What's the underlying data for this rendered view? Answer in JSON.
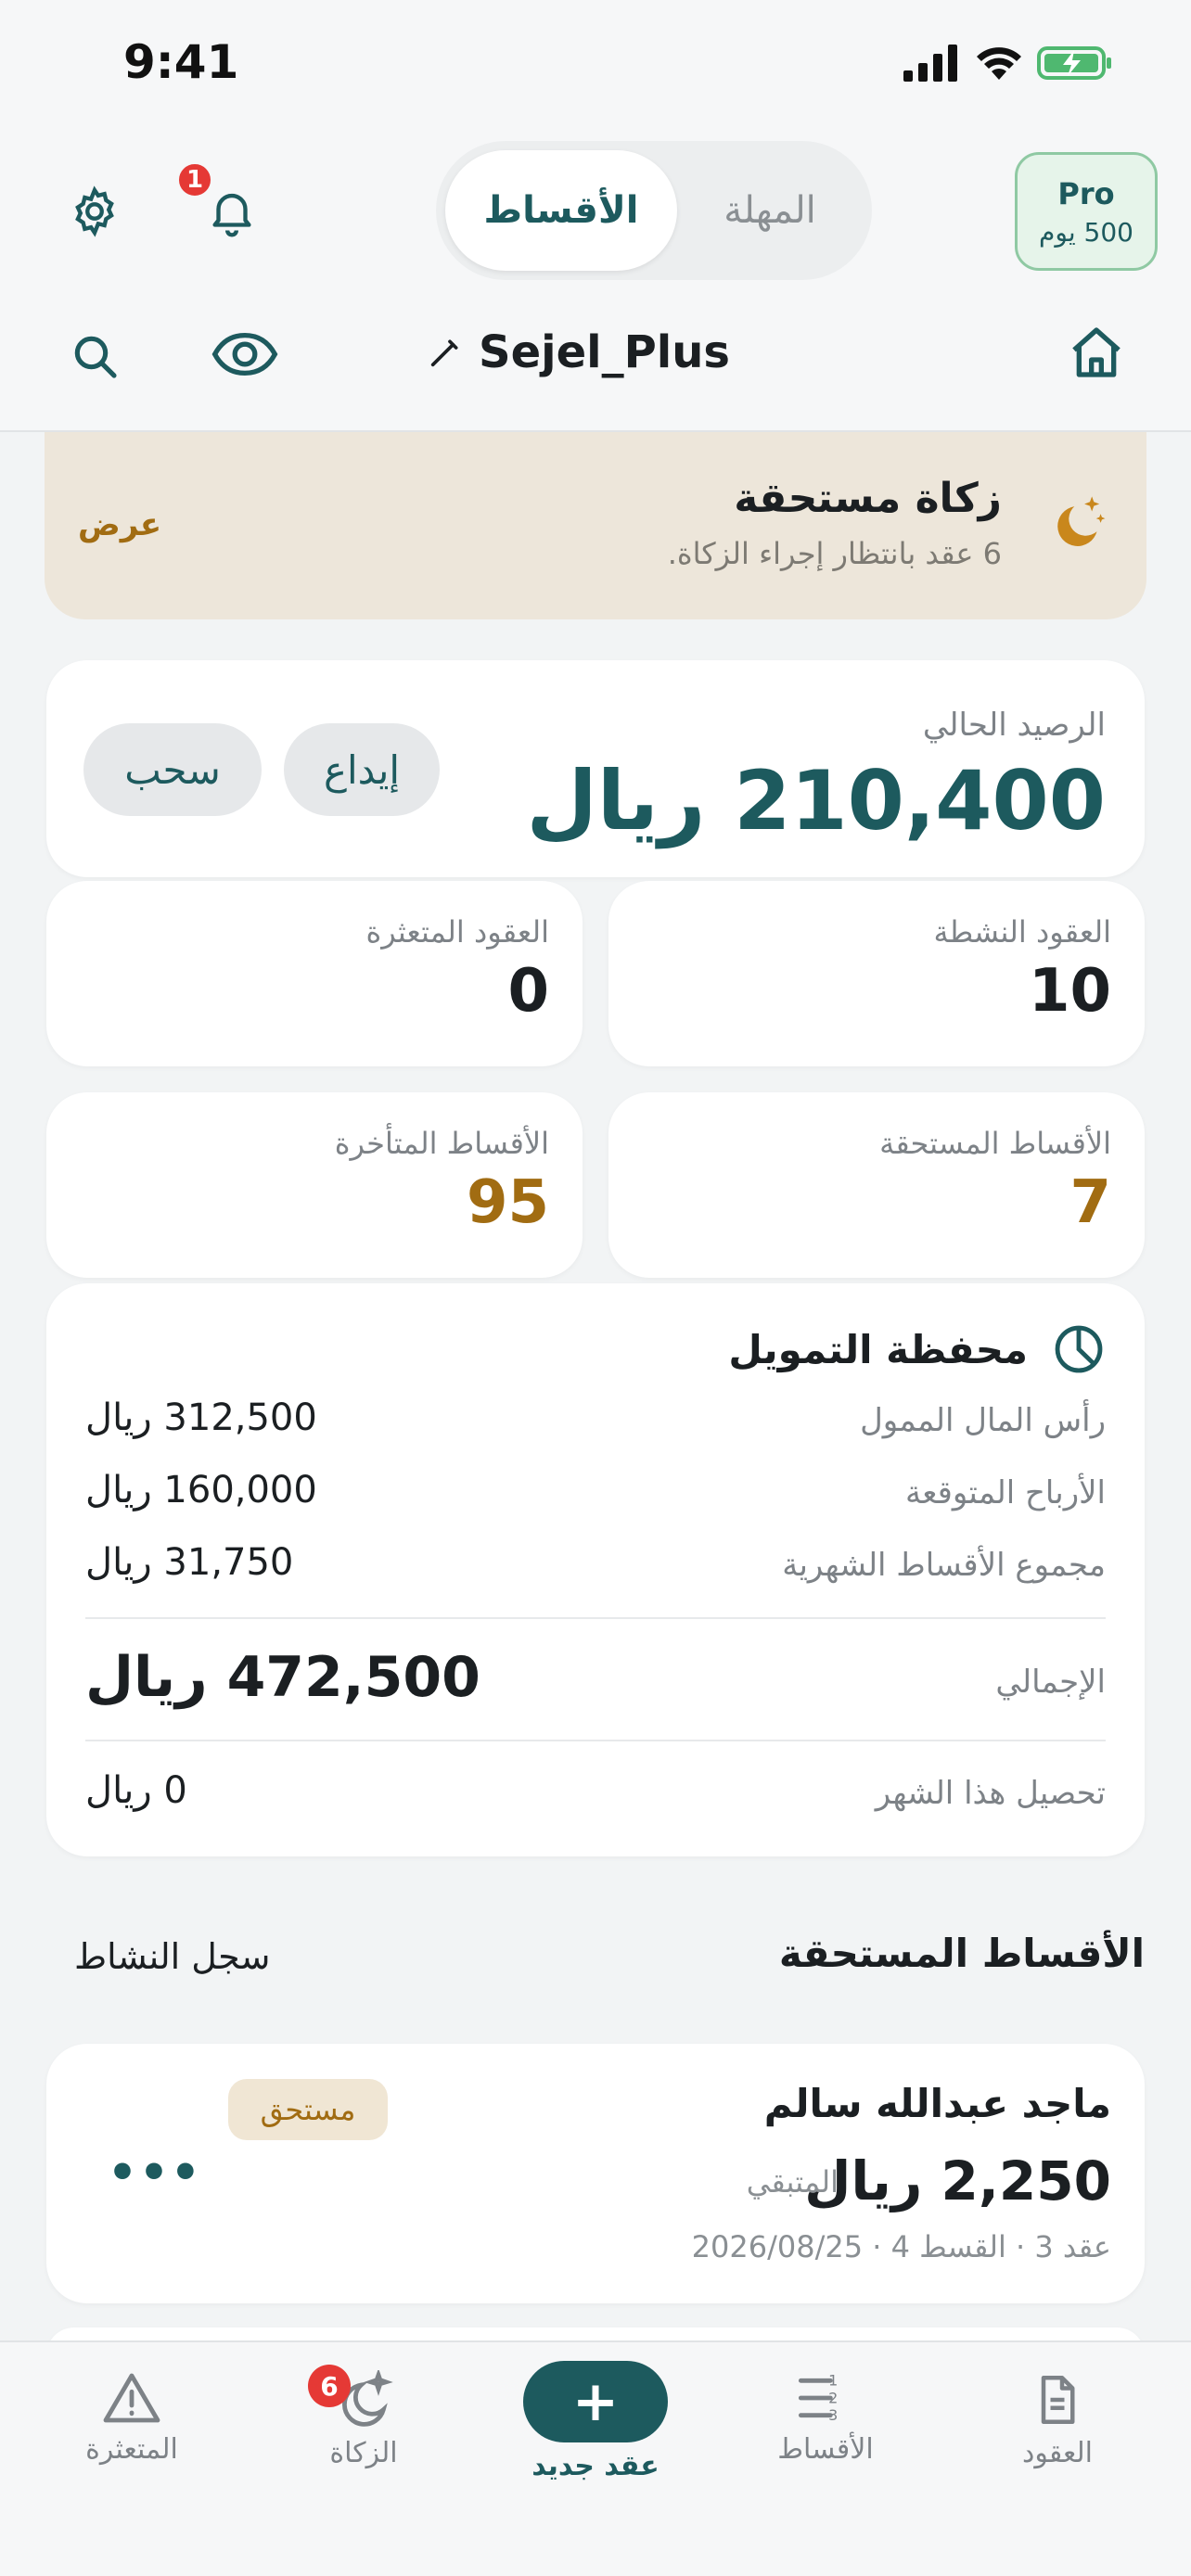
{
  "status_bar": {
    "time": "9:41"
  },
  "header": {
    "notification_count": "1",
    "segments": {
      "active": "الأقساط",
      "inactive": "المهلة"
    },
    "pro": {
      "title": "Pro",
      "subtitle": "500 يوم"
    },
    "username": "Sejel_Plus",
    "icons": [
      "gear-icon",
      "bell-icon",
      "search-icon",
      "eye-icon",
      "pencil-icon",
      "home-icon"
    ]
  },
  "zakat_banner": {
    "title": "زكاة مستحقة",
    "subtitle": "6 عقد بانتظار إجراء الزكاة.",
    "action": "عرض"
  },
  "balance": {
    "label": "الرصيد الحالي",
    "amount": "210,400 ريال",
    "deposit": "إيداع",
    "withdraw": "سحب"
  },
  "stats": {
    "active_contracts": {
      "label": "العقود النشطة",
      "value": "10"
    },
    "defaulted_contracts": {
      "label": "العقود المتعثرة",
      "value": "0"
    },
    "due_installments": {
      "label": "الأقساط المستحقة",
      "value": "7"
    },
    "late_installments": {
      "label": "الأقساط المتأخرة",
      "value": "95"
    }
  },
  "portfolio": {
    "title": "محفظة التمويل",
    "rows": [
      {
        "label": "رأس المال الممول",
        "value": "312,500 ريال"
      },
      {
        "label": "الأرباح المتوقعة",
        "value": "160,000 ريال"
      },
      {
        "label": "مجموع الأقساط الشهرية",
        "value": "31,750 ريال"
      }
    ],
    "total": {
      "label": "الإجمالي",
      "value": "472,500 ريال"
    },
    "month": {
      "label": "تحصيل هذا الشهر",
      "value": "0 ريال"
    }
  },
  "due_section": {
    "title": "الأقساط المستحقة",
    "activity_link": "سجل النشاط",
    "items": [
      {
        "name": "ماجد عبدالله سالم",
        "amount": "2,250 ريال",
        "remaining_label": "المتبقي",
        "meta": "عقد 3 · القسط 4 · 2026/08/25",
        "badge": "مستحق",
        "more": "•••"
      }
    ]
  },
  "tabbar": {
    "contracts": "العقود",
    "installments": "الأقساط",
    "new_contract": "عقد جديد",
    "new_contract_icon": "+",
    "zakat": "الزكاة",
    "zakat_badge": "6",
    "defaulted": "المتعثرة"
  },
  "colors": {
    "accent": "#1d5a5e",
    "gold": "#a16c12",
    "badge": "#e53935",
    "pro_bg": "#e6f4ea"
  }
}
